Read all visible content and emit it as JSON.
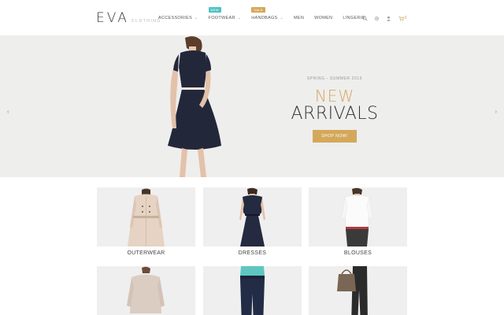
{
  "brand": {
    "name": "EVA",
    "tagline": "CLOTHING"
  },
  "nav": {
    "items": [
      {
        "label": "ACCESSORIES",
        "dropdown": true,
        "badge": null
      },
      {
        "label": "FOOTWEAR",
        "dropdown": true,
        "badge": "NEW"
      },
      {
        "label": "HANDBAGS",
        "dropdown": true,
        "badge": "SALE"
      },
      {
        "label": "MEN",
        "dropdown": false,
        "badge": null
      },
      {
        "label": "WOMEN",
        "dropdown": false,
        "badge": null
      },
      {
        "label": "LINGERIE",
        "dropdown": false,
        "badge": null
      }
    ]
  },
  "tools": {
    "cart_count": "0"
  },
  "hero": {
    "season": "SPRING - SUMMER 2015",
    "headline_1": "NEW",
    "headline_2": "ARRIVALS",
    "button": "SHOP NOW!"
  },
  "categories": [
    {
      "label": "OUTERWEAR"
    },
    {
      "label": "DRESSES"
    },
    {
      "label": "BLOUSES"
    },
    {
      "label": ""
    },
    {
      "label": ""
    },
    {
      "label": ""
    }
  ],
  "colors": {
    "accent": "#d4a85a",
    "badge_new": "#4fc3c3",
    "hero_bg": "#eeeeed"
  }
}
